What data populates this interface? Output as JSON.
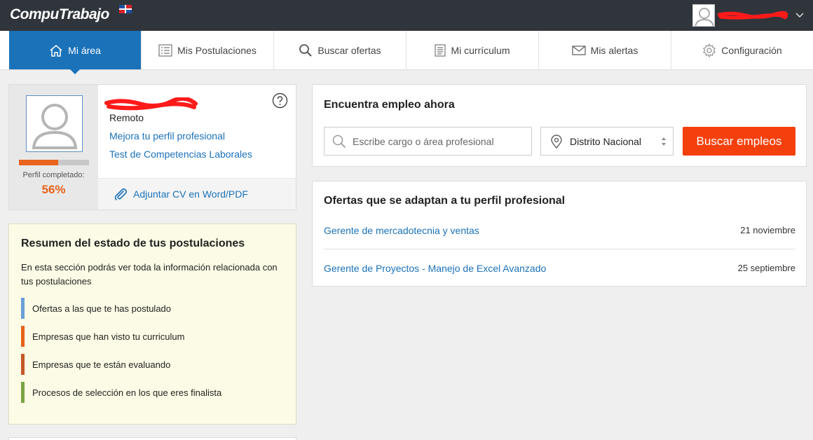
{
  "app": {
    "logo_text": "CompuTrabajo"
  },
  "nav": {
    "tabs": [
      {
        "label": "Mi área",
        "icon": "home-icon",
        "active": true
      },
      {
        "label": "Mis Postulaciones",
        "icon": "list-icon"
      },
      {
        "label": "Buscar ofertas",
        "icon": "search-icon"
      },
      {
        "label": "Mi currículum",
        "icon": "document-icon"
      },
      {
        "label": "Mis alertas",
        "icon": "mail-icon"
      },
      {
        "label": "Configuración",
        "icon": "gear-icon"
      }
    ]
  },
  "profile": {
    "location": "Remoto",
    "improve_link": "Mejora tu perfil profesional",
    "test_link": "Test de Competencias Laborales",
    "completion_label": "Perfil completado:",
    "completion_value": "56%",
    "completion_fraction": 0.56,
    "attach_cv": "Adjuntar CV en Word/PDF"
  },
  "summary": {
    "title": "Resumen del estado de tus postulaciones",
    "description": "En esta sección podrás ver toda la información relacionada con tus postulaciones",
    "items": [
      {
        "label": "Ofertas a las que te has postulado",
        "color": "#6a9fd6"
      },
      {
        "label": "Empresas que han visto tu curriculum",
        "color": "#e8631c"
      },
      {
        "label": "Empresas que te están evaluando",
        "color": "#c4582a"
      },
      {
        "label": "Procesos de selección en los que eres finalista",
        "color": "#7aa545"
      }
    ]
  },
  "search": {
    "title": "Encuentra empleo ahora",
    "placeholder": "Escribe cargo o área profesional",
    "location": "Distrito Nacional",
    "button": "Buscar empleos"
  },
  "offers": {
    "title": "Ofertas que se adaptan a tu perfil profesional",
    "items": [
      {
        "title": "Gerente de mercadotecnia y ventas",
        "date": "21 noviembre"
      },
      {
        "title": "Gerente de Proyectos - Manejo de Excel Avanzado",
        "date": "25 septiembre"
      }
    ]
  },
  "colors": {
    "accent": "#1b72b9",
    "topbar": "#30353c",
    "cta": "#f4400c",
    "progress": "#e8631c"
  }
}
